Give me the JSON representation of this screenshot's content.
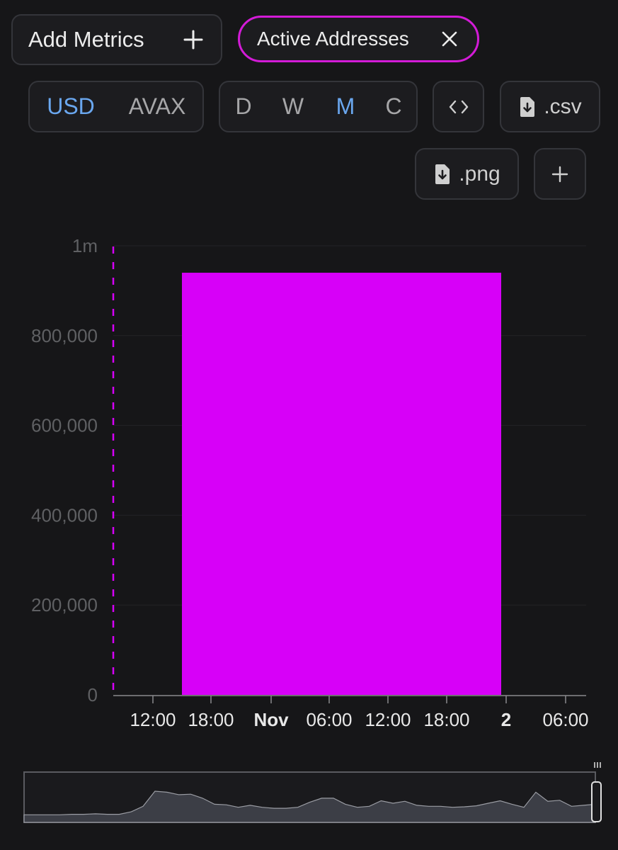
{
  "toolbar": {
    "add_metrics_label": "Add Metrics",
    "metric_chip_label": "Active Addresses",
    "currency": {
      "options": [
        "USD",
        "AVAX"
      ],
      "selected": "USD"
    },
    "interval": {
      "options": [
        "D",
        "W",
        "M",
        "C"
      ],
      "selected": "M"
    },
    "code_label": "<>",
    "csv_label": ".csv",
    "png_label": ".png",
    "add_label": "+"
  },
  "colors": {
    "accent": "#d700f8",
    "chip_border": "#d31bd7",
    "active_toggle": "#6aa7ef",
    "background": "#161618"
  },
  "icons": [
    "plus-icon",
    "close-icon",
    "code-icon",
    "file-download-icon",
    "plus-icon"
  ],
  "chart_data": {
    "type": "bar",
    "series": [
      {
        "color": "#d700f8",
        "values": [
          940000
        ],
        "x_start": "Oct 31 15:00",
        "x_end": "Nov 2 00:00"
      }
    ],
    "y_ticks": [
      "0",
      "200,000",
      "400,000",
      "600,000",
      "800,000",
      "1m"
    ],
    "ylim": [
      0,
      1000000
    ],
    "x_tick_labels": [
      {
        "label": "12:00",
        "bold": false
      },
      {
        "label": "18:00",
        "bold": false
      },
      {
        "label": "Nov",
        "bold": true
      },
      {
        "label": "06:00",
        "bold": false
      },
      {
        "label": "12:00",
        "bold": false
      },
      {
        "label": "18:00",
        "bold": false
      },
      {
        "label": "2",
        "bold": true
      },
      {
        "label": "06:00",
        "bold": false
      }
    ],
    "grid": true,
    "navigator": {
      "values": [
        0.15,
        0.15,
        0.15,
        0.15,
        0.16,
        0.16,
        0.17,
        0.16,
        0.16,
        0.21,
        0.32,
        0.62,
        0.6,
        0.55,
        0.56,
        0.48,
        0.36,
        0.35,
        0.3,
        0.34,
        0.3,
        0.28,
        0.28,
        0.3,
        0.4,
        0.48,
        0.48,
        0.36,
        0.3,
        0.32,
        0.43,
        0.38,
        0.42,
        0.34,
        0.32,
        0.32,
        0.3,
        0.31,
        0.33,
        0.38,
        0.43,
        0.36,
        0.3,
        0.6,
        0.42,
        0.44,
        0.32,
        0.34,
        0.36
      ]
    }
  }
}
